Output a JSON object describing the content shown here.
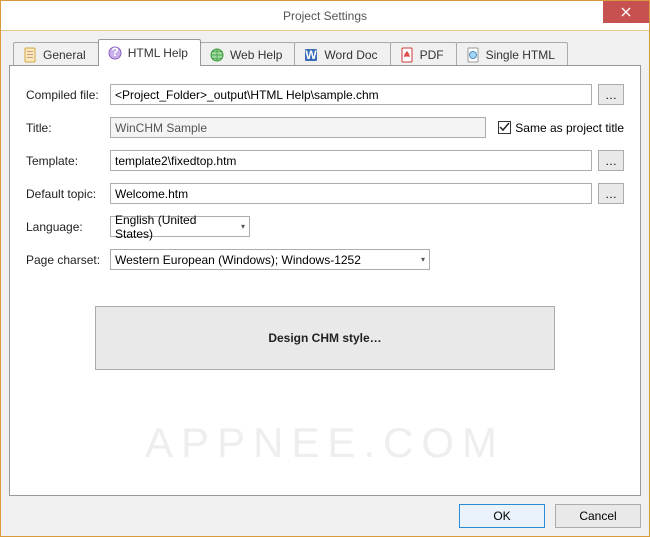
{
  "window": {
    "title": "Project Settings"
  },
  "tabs": {
    "general": "General",
    "htmlhelp": "HTML Help",
    "webhelp": "Web Help",
    "worddoc": "Word Doc",
    "pdf": "PDF",
    "singlehtml": "Single HTML"
  },
  "labels": {
    "compiled_file": "Compiled file:",
    "title": "Title:",
    "template": "Template:",
    "default_topic": "Default topic:",
    "language": "Language:",
    "page_charset": "Page charset:",
    "same_as_project": "Same as project title"
  },
  "values": {
    "compiled_file": "<Project_Folder>_output\\HTML Help\\sample.chm",
    "title": "WinCHM Sample",
    "template": "template2\\fixedtop.htm",
    "default_topic": "Welcome.htm",
    "language": "English (United States)",
    "page_charset": "Western European (Windows); Windows-1252",
    "same_as_project_checked": true
  },
  "buttons": {
    "browse": "…",
    "design": "Design CHM style…",
    "ok": "OK",
    "cancel": "Cancel"
  },
  "watermark": "APPNEE.COM"
}
